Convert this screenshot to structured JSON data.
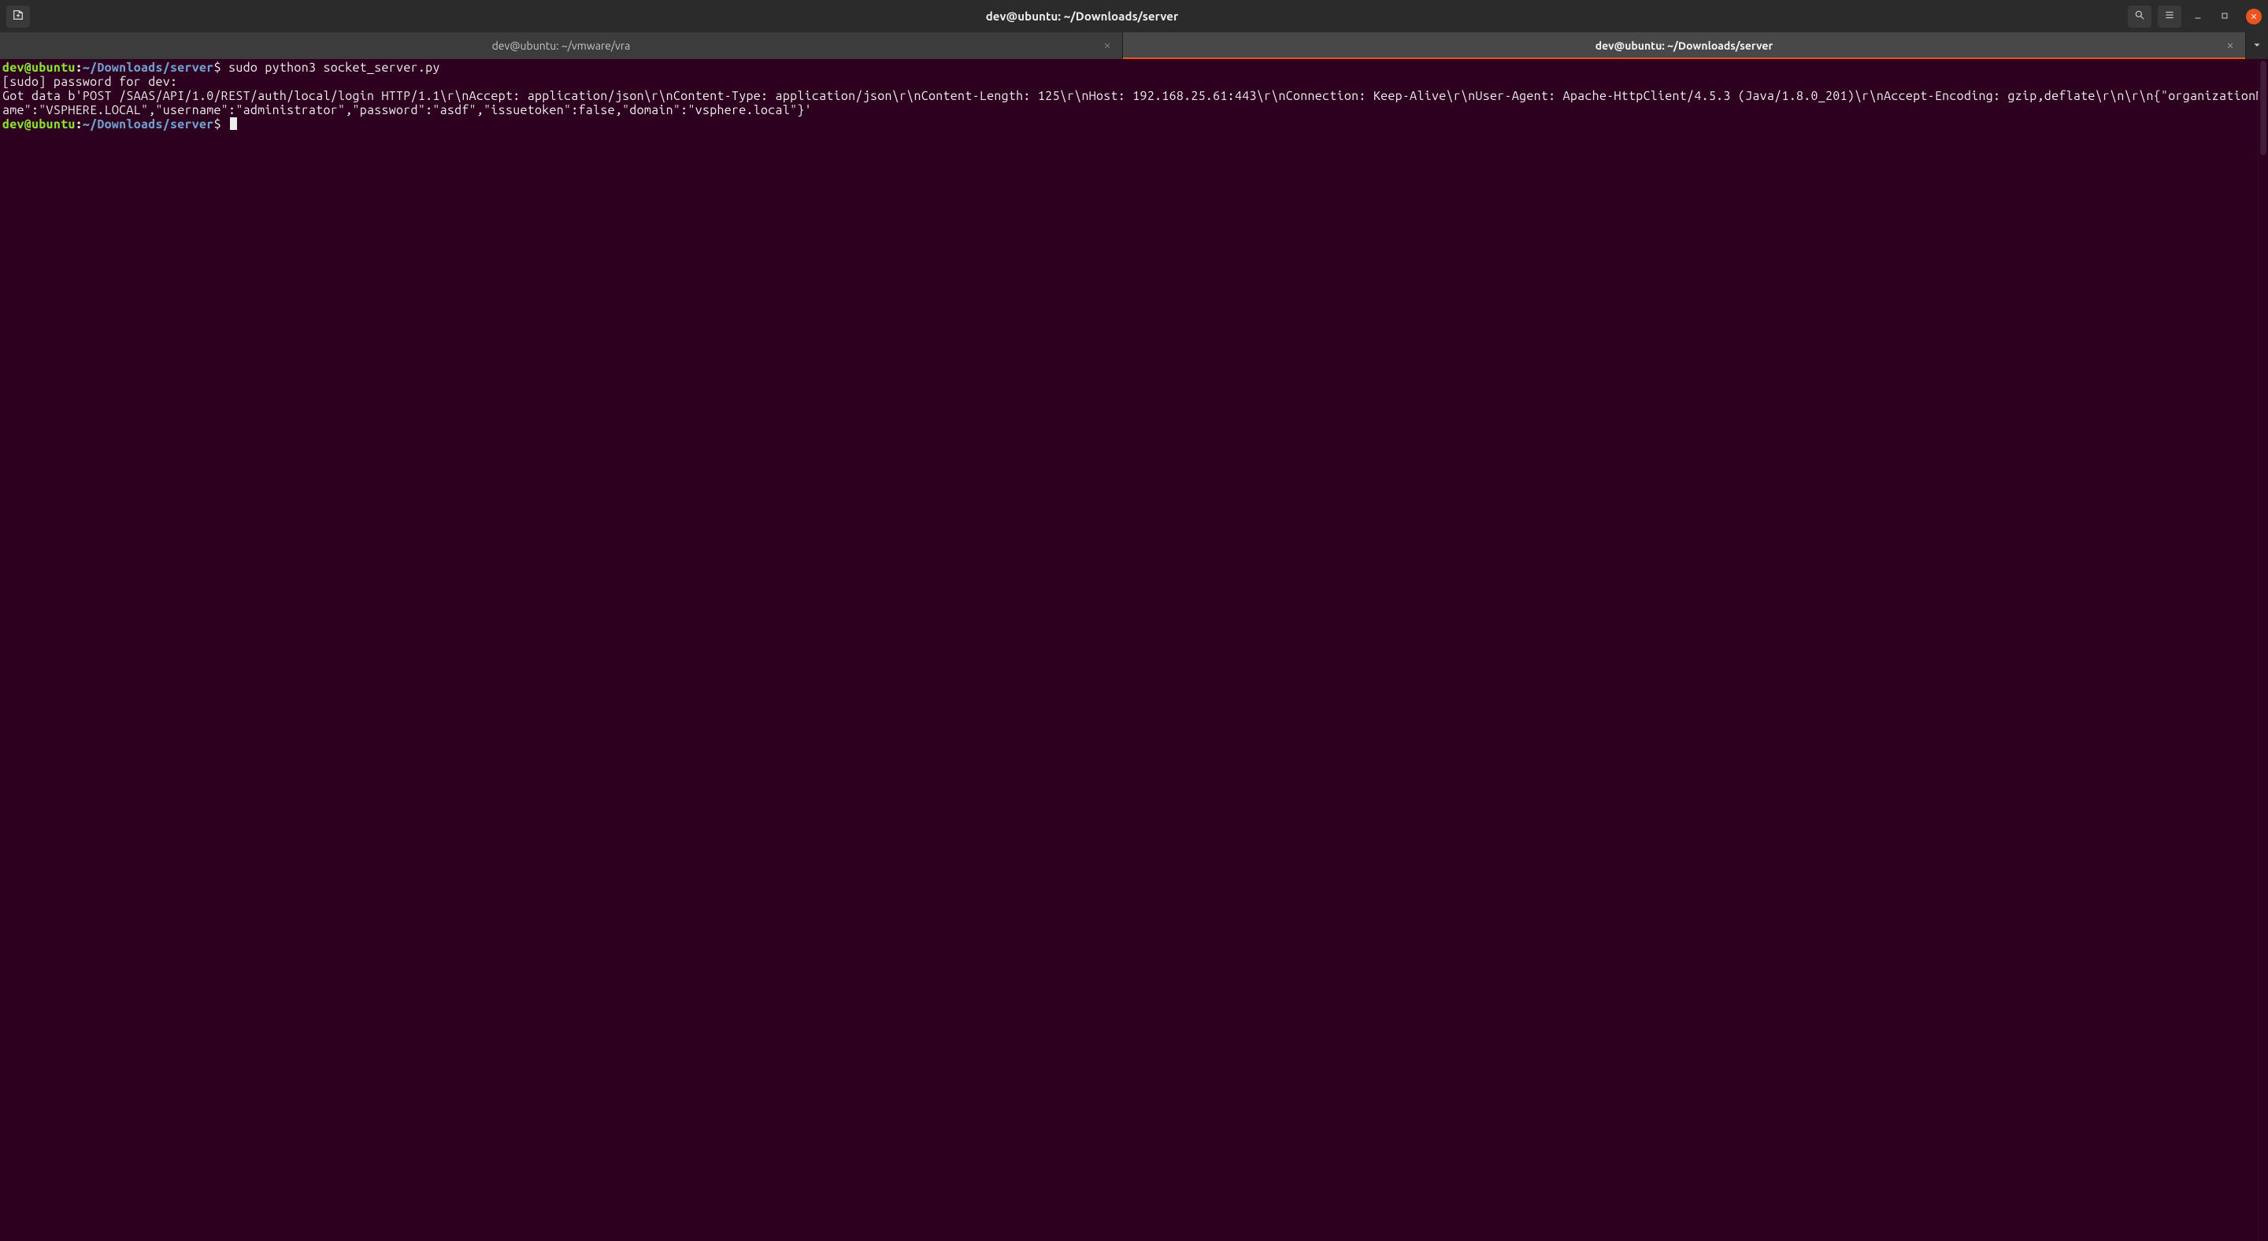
{
  "window": {
    "title": "dev@ubuntu: ~/Downloads/server"
  },
  "tabs": [
    {
      "label": "dev@ubuntu: ~/vmware/vra",
      "active": false
    },
    {
      "label": "dev@ubuntu: ~/Downloads/server",
      "active": true
    }
  ],
  "prompt": {
    "user_host": "dev@ubuntu",
    "colon": ":",
    "path": "~/Downloads/server",
    "dollar": "$"
  },
  "lines": {
    "cmd1": " sudo python3 socket_server.py",
    "out1": "[sudo] password for dev:",
    "out2": "Got data b'POST /SAAS/API/1.0/REST/auth/local/login HTTP/1.1\\r\\nAccept: application/json\\r\\nContent-Type: application/json\\r\\nContent-Length: 125\\r\\nHost: 192.168.25.61:443\\r\\nConnection: Keep-Alive\\r\\nUser-Agent: Apache-HttpClient/4.5.3 (Java/1.8.0_201)\\r\\nAccept-Encoding: gzip,deflate\\r\\n\\r\\n{\"organizationName\":\"VSPHERE.LOCAL\",\"username\":\"administrator\",\"password\":\"asdf\",\"issuetoken\":false,\"domain\":\"vsphere.local\"}'",
    "cmd2": " "
  }
}
